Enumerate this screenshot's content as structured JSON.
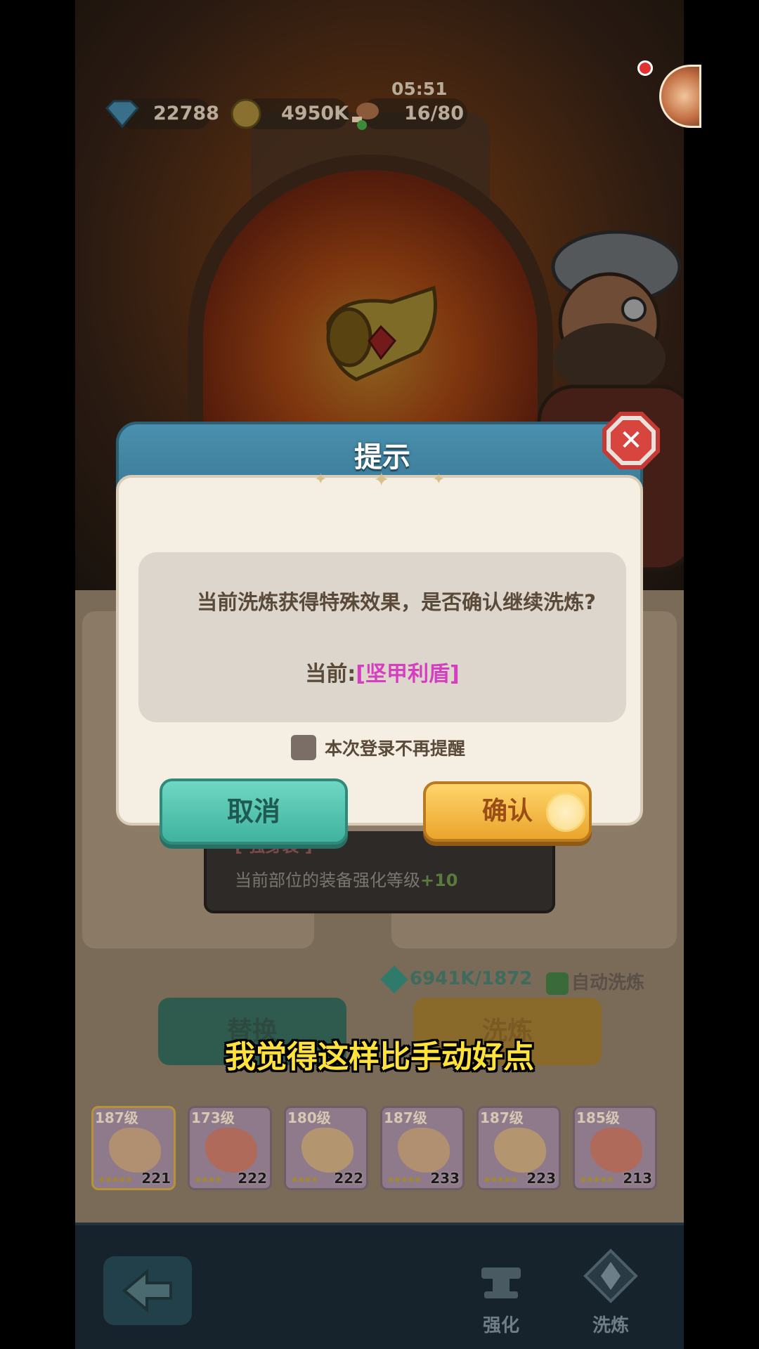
{
  "resources": {
    "gems": "22788",
    "gold": "4950K",
    "stamina": "16/80",
    "timer": "05:51"
  },
  "dialog": {
    "title": "提示",
    "message": "当前洗炼获得特殊效果，是否确认继续洗炼?",
    "current_label": "当前:",
    "current_value": "[坚甲利盾]",
    "checkbox_label": "本次登录不再提醒",
    "cancel_label": "取消",
    "confirm_label": "确认",
    "close_symbol": "✕"
  },
  "effect": {
    "name": "[ 强身装 ]",
    "desc": "当前部位的装备强化等级",
    "bonus": "+10"
  },
  "refine": {
    "cost": "6941K/1872",
    "auto_label": "自动洗炼",
    "replace_label": "替换",
    "refine_label": "洗炼"
  },
  "equipment": [
    {
      "level": "187级",
      "power": "221"
    },
    {
      "level": "173级",
      "power": "222"
    },
    {
      "level": "180级",
      "power": "222"
    },
    {
      "level": "187级",
      "power": "233"
    },
    {
      "level": "187级",
      "power": "223"
    },
    {
      "level": "185级",
      "power": "213"
    }
  ],
  "nav": {
    "enhance_label": "强化",
    "refine_label": "洗炼"
  },
  "subtitle": "我觉得这样比手动好点",
  "colors": {
    "highlight": "#d63ec0",
    "confirm": "#eaa52c",
    "cancel": "#3fb39e",
    "subtitle": "#ffe23a"
  }
}
